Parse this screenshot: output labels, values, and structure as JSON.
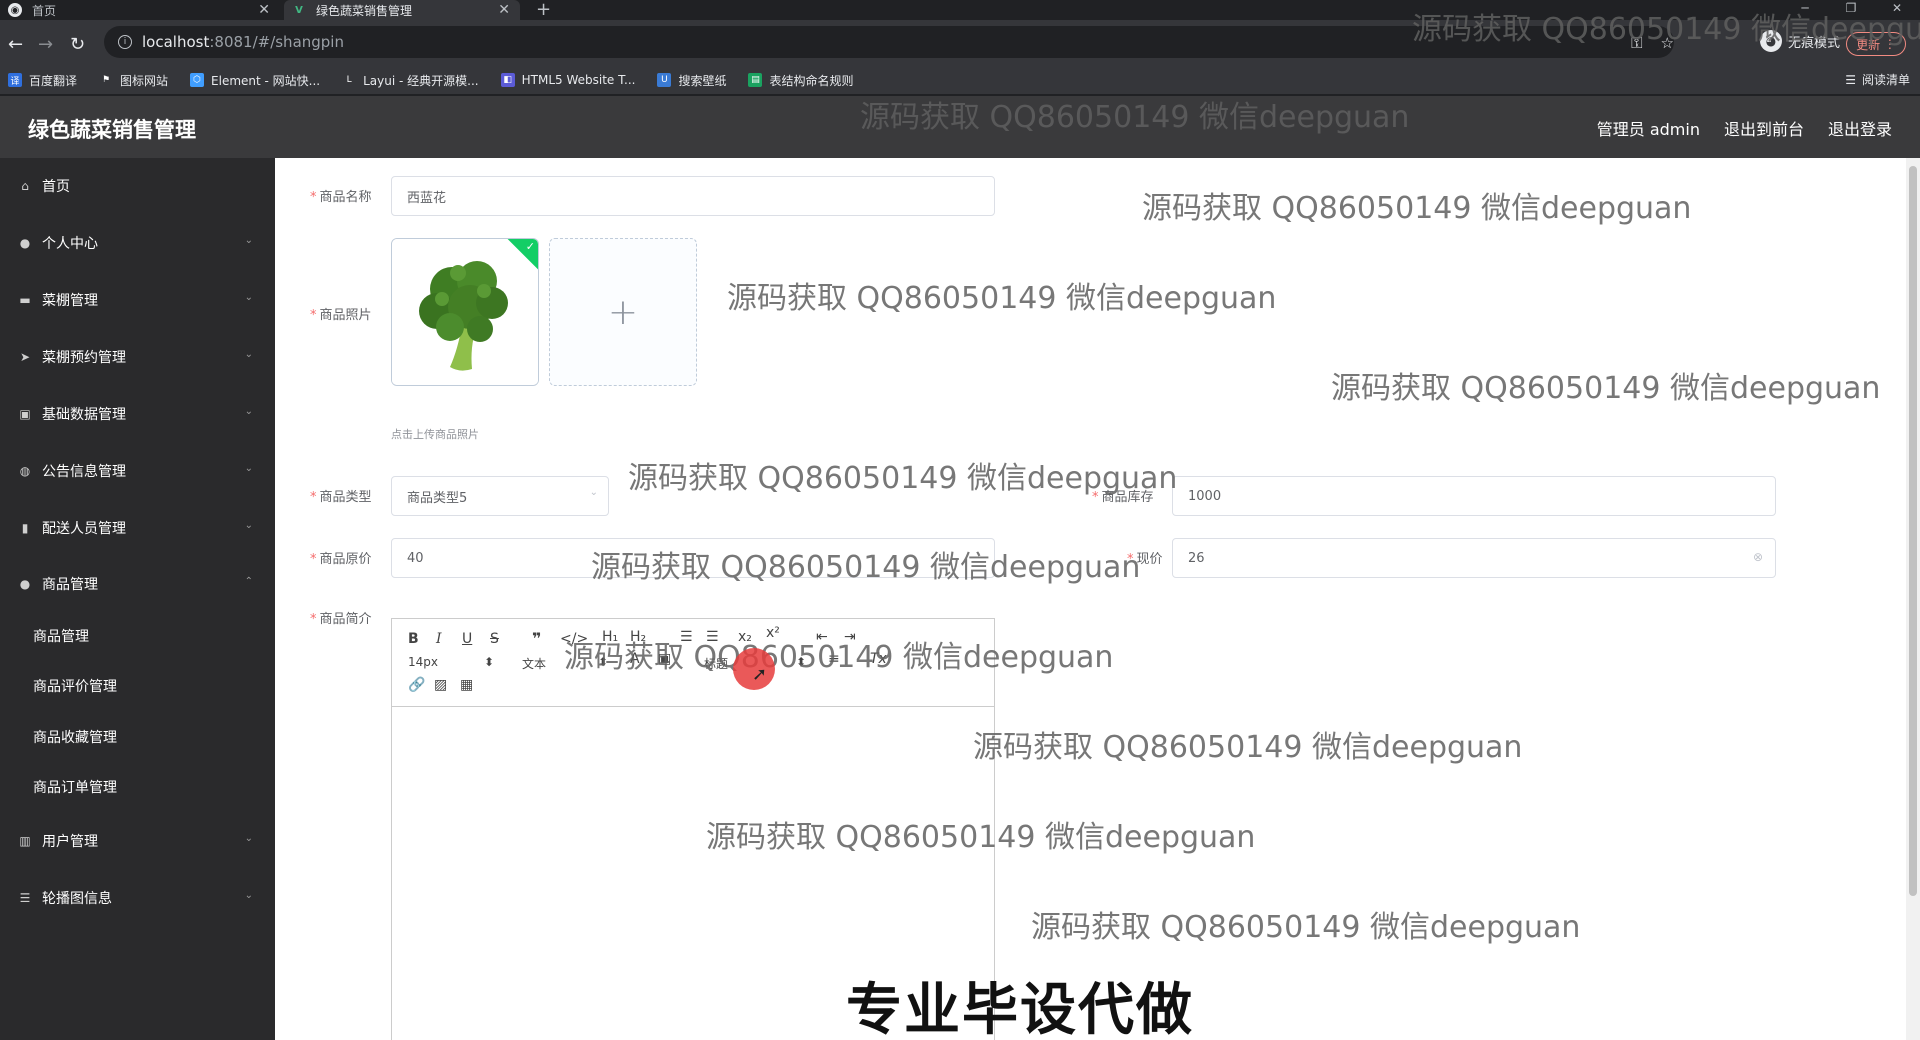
{
  "browser": {
    "tabs": [
      {
        "title": "首页",
        "active": false
      },
      {
        "title": "绿色蔬菜销售管理",
        "active": true
      }
    ],
    "url_host": "localhost",
    "url_rest": ":8081/#/shangpin",
    "incognito_label": "无痕模式",
    "update_label": "更新",
    "reading_list_label": "阅读清单",
    "bookmarks": [
      {
        "label": "百度翻译",
        "icon": "translate-icon",
        "color": "#2f6fde"
      },
      {
        "label": "图标网站",
        "icon": "flag-icon",
        "color": "#35363a"
      },
      {
        "label": "Element - 网站快...",
        "icon": "element-icon",
        "color": "#409eff"
      },
      {
        "label": "Layui - 经典开源模...",
        "icon": "layui-icon",
        "color": "#35363a"
      },
      {
        "label": "HTML5 Website T...",
        "icon": "html5-icon",
        "color": "#5b5bd6"
      },
      {
        "label": "搜索壁纸",
        "icon": "wallpaper-icon",
        "color": "#3a7bd5"
      },
      {
        "label": "表结构命名规则",
        "icon": "table-icon",
        "color": "#1aa260"
      }
    ]
  },
  "app": {
    "title": "绿色蔬菜销售管理",
    "header_links": [
      "管理员 admin",
      "退出到前台",
      "退出登录"
    ]
  },
  "sidebar": {
    "items": [
      {
        "label": "首页",
        "icon": "home-icon",
        "chevron": false
      },
      {
        "label": "个人中心",
        "icon": "user-icon",
        "chevron": true
      },
      {
        "label": "菜棚管理",
        "icon": "message-icon",
        "chevron": true
      },
      {
        "label": "菜棚预约管理",
        "icon": "send-icon",
        "chevron": true
      },
      {
        "label": "基础数据管理",
        "icon": "clipboard-icon",
        "chevron": true
      },
      {
        "label": "公告信息管理",
        "icon": "globe-icon",
        "chevron": true
      },
      {
        "label": "配送人员管理",
        "icon": "bar-chart-icon",
        "chevron": true
      },
      {
        "label": "商品管理",
        "icon": "location-icon",
        "chevron": "up"
      },
      {
        "label": "用户管理",
        "icon": "chart-icon",
        "chevron": true
      },
      {
        "label": "轮播图信息",
        "icon": "sliders-icon",
        "chevron": true
      }
    ],
    "sub_items": [
      "商品管理",
      "商品评价管理",
      "商品收藏管理",
      "商品订单管理"
    ]
  },
  "form": {
    "name_label": "商品名称",
    "name_value": "西蓝花",
    "photo_label": "商品照片",
    "photo_tip": "点击上传商品照片",
    "type_label": "商品类型",
    "type_value": "商品类型5",
    "stock_label": "商品库存",
    "stock_value": "1000",
    "orig_price_label": "商品原价",
    "orig_price_value": "40",
    "now_price_label": "现价",
    "now_price_value": "26",
    "intro_label": "商品简介"
  },
  "editor": {
    "font_size": "14px",
    "text_label": "文本",
    "heading_label": "标题"
  },
  "overlay": {
    "watermark": "源码获取 QQ86050149 微信deepguan",
    "banner": "专业毕设代做"
  }
}
